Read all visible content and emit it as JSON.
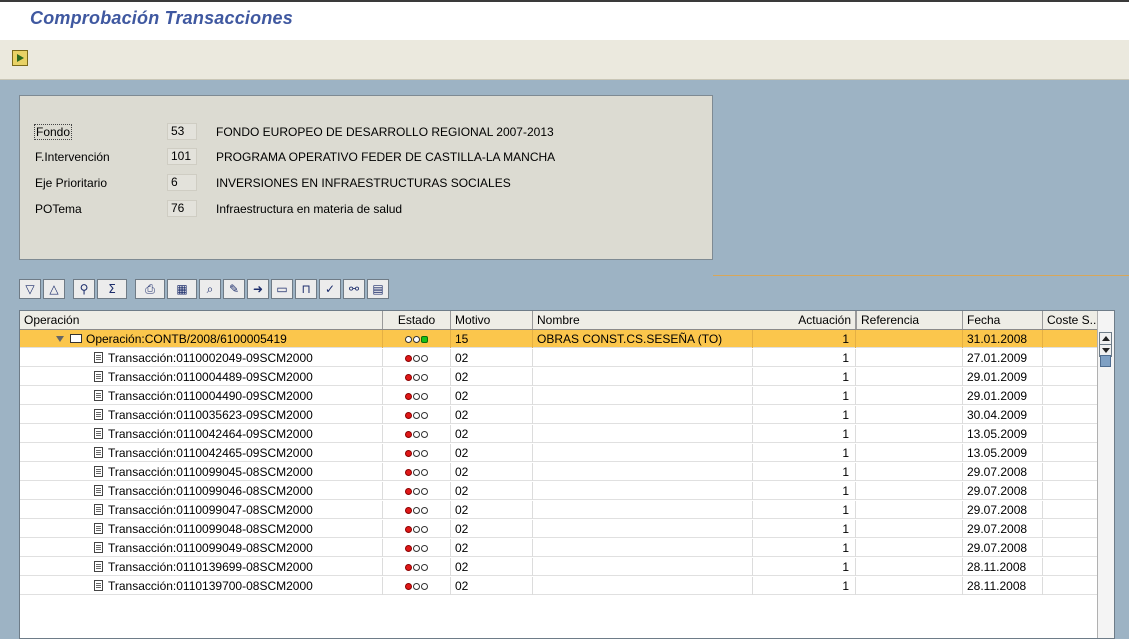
{
  "window": {
    "title": "Comprobación Transacciones"
  },
  "appbar": {
    "execute_icon": "execute-icon"
  },
  "header": {
    "fields": [
      {
        "label": "Fondo",
        "code": "53",
        "description": "FONDO EUROPEO DE DESARROLLO REGIONAL  2007-2013"
      },
      {
        "label": "F.Intervención",
        "code": "101",
        "description": "PROGRAMA OPERATIVO FEDER DE CASTILLA-LA MANCHA"
      },
      {
        "label": "Eje Prioritario",
        "code": "6",
        "description": "INVERSIONES EN INFRAESTRUCTURAS SOCIALES"
      },
      {
        "label": "POTema",
        "code": "76",
        "description": "Infraestructura en materia de salud"
      }
    ]
  },
  "toolbar": {
    "buttons": [
      {
        "name": "expand-all-icon",
        "glyph": "▽"
      },
      {
        "name": "collapse-all-icon",
        "glyph": "△"
      },
      {
        "name": "find-icon",
        "glyph": "⚲"
      },
      {
        "name": "sum-icon",
        "glyph": "Σ"
      },
      {
        "name": "print-icon",
        "glyph": "⎙"
      },
      {
        "name": "layout-icon",
        "glyph": "▦"
      },
      {
        "name": "zoom-icon",
        "glyph": "⌕"
      },
      {
        "name": "edit-icon",
        "glyph": "✎"
      },
      {
        "name": "export-icon",
        "glyph": "➜"
      },
      {
        "name": "folder-icon",
        "glyph": "▭"
      },
      {
        "name": "open-folder-icon",
        "glyph": "⊓"
      },
      {
        "name": "filter-icon",
        "glyph": "✓"
      },
      {
        "name": "binoculars-icon",
        "glyph": "⚯"
      },
      {
        "name": "hierarchy-icon",
        "glyph": "▤"
      }
    ]
  },
  "grid": {
    "columns": [
      "Operación",
      "Estado",
      "Motivo",
      "Nombre",
      "Actuación",
      "Referencia",
      "Fecha",
      "Coste S..."
    ],
    "parent": {
      "operacion": "Operación:CONTB/2008/6100005419",
      "motivo": "15",
      "nombre": "OBRAS CONST.CS.SESEÑA (TO)",
      "actuacion": "1",
      "fecha": "31.01.2008"
    },
    "rows": [
      {
        "operacion": "Transacción:0110002049-09SCM2000",
        "motivo": "02",
        "actuacion": "1",
        "fecha": "27.01.2009"
      },
      {
        "operacion": "Transacción:0110004489-09SCM2000",
        "motivo": "02",
        "actuacion": "1",
        "fecha": "29.01.2009"
      },
      {
        "operacion": "Transacción:0110004490-09SCM2000",
        "motivo": "02",
        "actuacion": "1",
        "fecha": "29.01.2009"
      },
      {
        "operacion": "Transacción:0110035623-09SCM2000",
        "motivo": "02",
        "actuacion": "1",
        "fecha": "30.04.2009"
      },
      {
        "operacion": "Transacción:0110042464-09SCM2000",
        "motivo": "02",
        "actuacion": "1",
        "fecha": "13.05.2009"
      },
      {
        "operacion": "Transacción:0110042465-09SCM2000",
        "motivo": "02",
        "actuacion": "1",
        "fecha": "13.05.2009"
      },
      {
        "operacion": "Transacción:0110099045-08SCM2000",
        "motivo": "02",
        "actuacion": "1",
        "fecha": "29.07.2008"
      },
      {
        "operacion": "Transacción:0110099046-08SCM2000",
        "motivo": "02",
        "actuacion": "1",
        "fecha": "29.07.2008"
      },
      {
        "operacion": "Transacción:0110099047-08SCM2000",
        "motivo": "02",
        "actuacion": "1",
        "fecha": "29.07.2008"
      },
      {
        "operacion": "Transacción:0110099048-08SCM2000",
        "motivo": "02",
        "actuacion": "1",
        "fecha": "29.07.2008"
      },
      {
        "operacion": "Transacción:0110099049-08SCM2000",
        "motivo": "02",
        "actuacion": "1",
        "fecha": "29.07.2008"
      },
      {
        "operacion": "Transacción:0110139699-08SCM2000",
        "motivo": "02",
        "actuacion": "1",
        "fecha": "28.11.2008"
      },
      {
        "operacion": "Transacción:0110139700-08SCM2000",
        "motivo": "02",
        "actuacion": "1",
        "fecha": "28.11.2008"
      }
    ]
  },
  "colors": {
    "selected_row": "#fbc64c",
    "background": "#9db3c4",
    "light_red": "#e01818",
    "light_green": "#18c018"
  }
}
